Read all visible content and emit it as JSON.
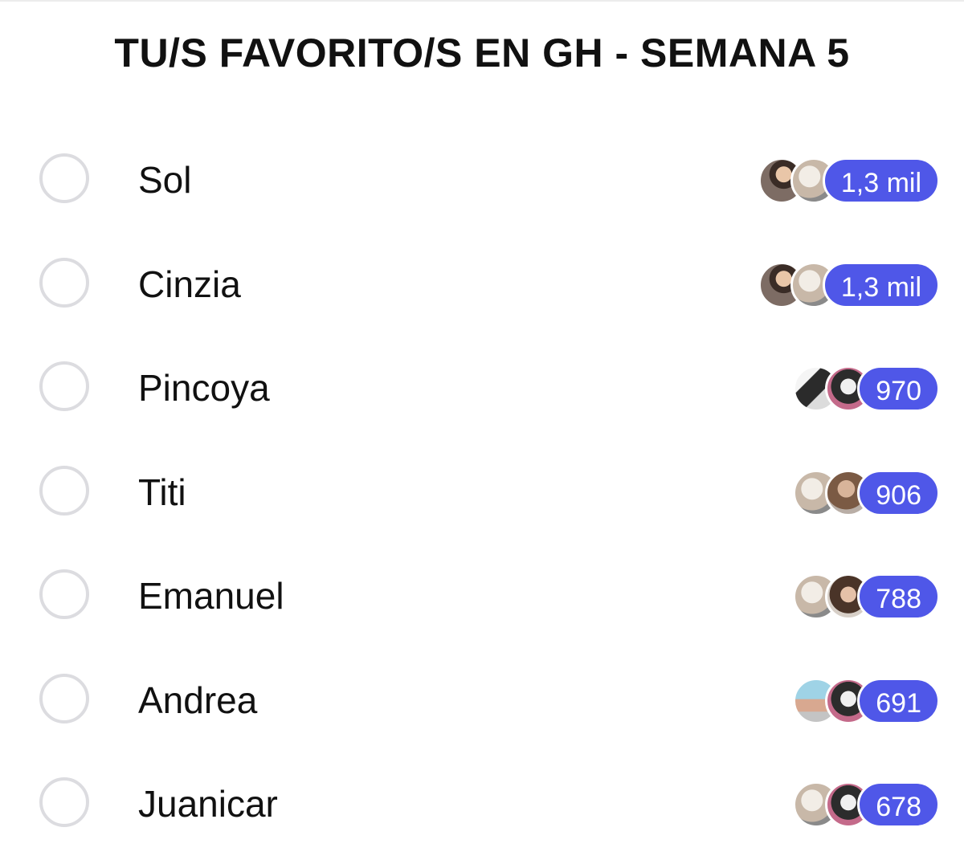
{
  "poll": {
    "title": "TU/S FAVORITO/S EN GH - SEMANA 5",
    "options": [
      {
        "label": "Sol",
        "count": "1,3 mil",
        "avatars": [
          "voter-avatar",
          "voter-avatar"
        ]
      },
      {
        "label": "Cinzia",
        "count": "1,3 mil",
        "avatars": [
          "voter-avatar",
          "voter-avatar"
        ]
      },
      {
        "label": "Pincoya",
        "count": "970",
        "avatars": [
          "voter-avatar",
          "voter-avatar"
        ]
      },
      {
        "label": "Titi",
        "count": "906",
        "avatars": [
          "voter-avatar",
          "voter-avatar"
        ]
      },
      {
        "label": "Emanuel",
        "count": "788",
        "avatars": [
          "voter-avatar",
          "voter-avatar"
        ]
      },
      {
        "label": "Andrea",
        "count": "691",
        "avatars": [
          "voter-avatar",
          "voter-avatar"
        ]
      },
      {
        "label": "Juanicar",
        "count": "678",
        "avatars": [
          "voter-avatar",
          "voter-avatar"
        ]
      }
    ]
  },
  "colors": {
    "badge": "#4f57e8",
    "radio_border": "#dcdce0",
    "text": "#111111"
  }
}
